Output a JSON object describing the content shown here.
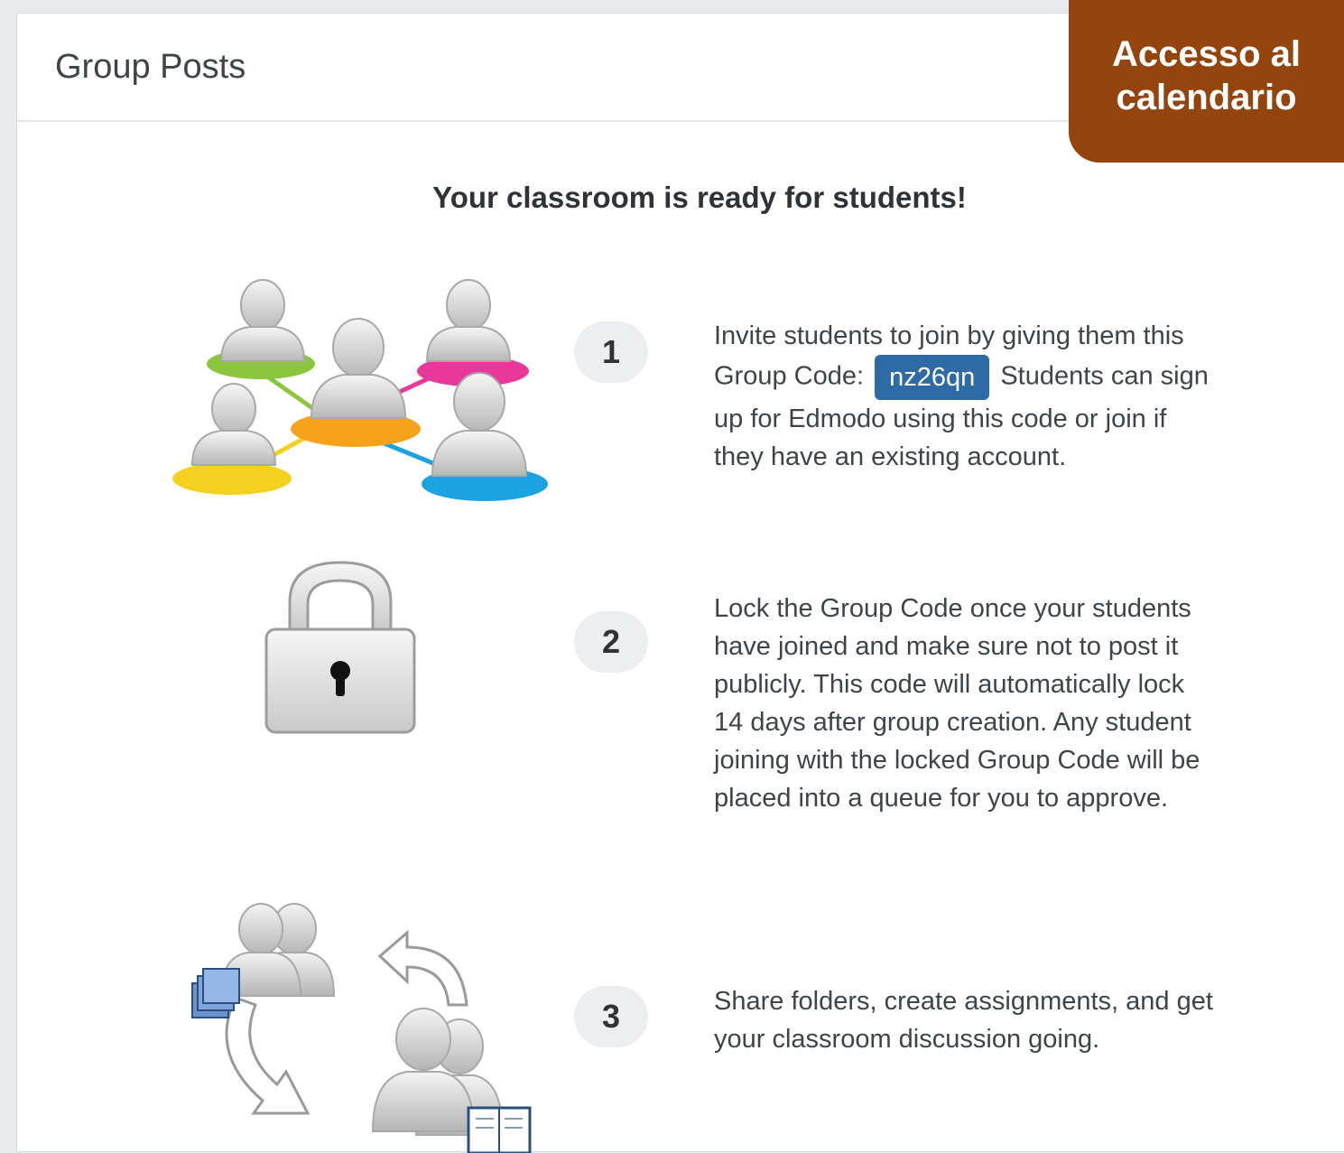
{
  "header": {
    "title": "Group Posts"
  },
  "banner": {
    "line1": "Accesso al",
    "line2": "calendario"
  },
  "main": {
    "ready_title": "Your classroom is ready for students!",
    "steps": [
      {
        "number": "1",
        "text_before": "Invite students to join by giving them this Group Code:",
        "group_code": "nz26qn",
        "text_after": "Students can sign up for Edmodo using this code or join if they have an existing account.",
        "icon": "students-network-icon"
      },
      {
        "number": "2",
        "text": "Lock the Group Code once your students have joined and make sure not to post it publicly. This code will automatically lock 14 days after group creation. Any student joining with the locked Group Code will be placed into a queue for you to approve.",
        "icon": "padlock-icon"
      },
      {
        "number": "3",
        "text": "Share folders, create assignments, and get your classroom discussion going.",
        "icon": "share-exchange-icon"
      }
    ]
  },
  "colors": {
    "banner_bg": "#94450d",
    "code_pill_bg": "#2e6aa5",
    "badge_bg": "#eceeef",
    "node_green": "#8cc63f",
    "node_pink": "#e8399b",
    "node_orange": "#f7a21b",
    "node_yellow": "#f4d11e",
    "node_blue": "#1aa3e0"
  }
}
